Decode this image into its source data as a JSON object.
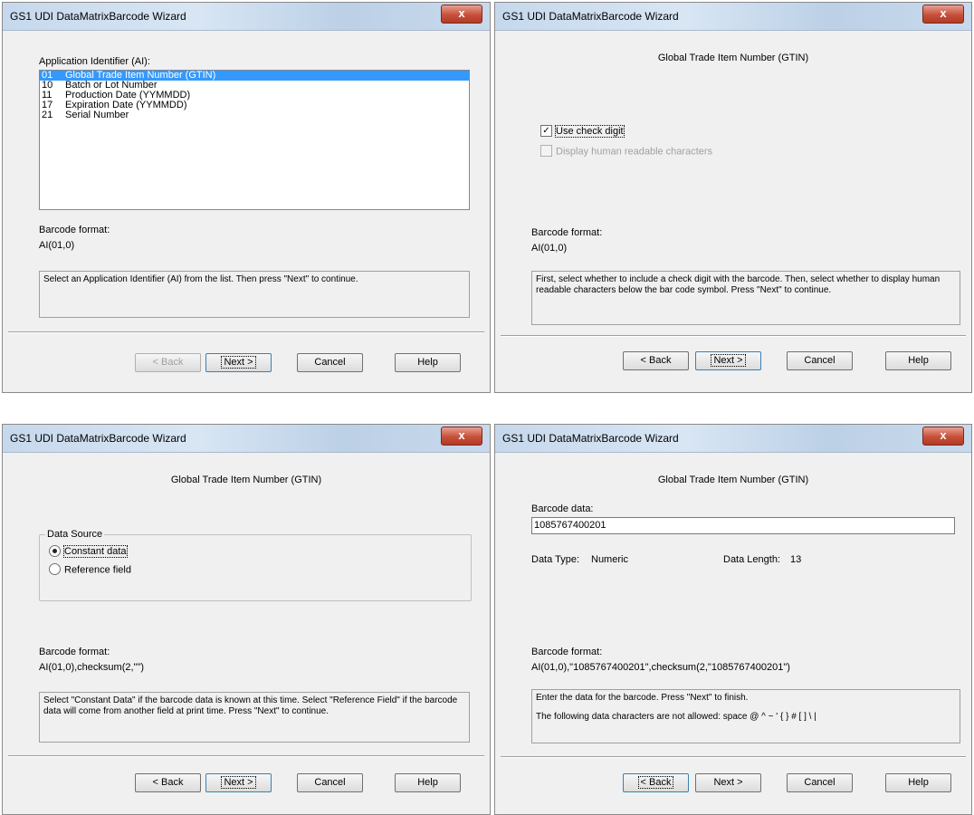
{
  "window_title": "GS1 UDI DataMatrixBarcode Wizard",
  "close_glyph": "x",
  "buttons": {
    "back": "< Back",
    "next": "Next >",
    "cancel": "Cancel",
    "help": "Help"
  },
  "barcode_format_label": "Barcode format:",
  "panel1": {
    "ai_label": "Application Identifier (AI):",
    "ai_items": [
      {
        "code": "01",
        "name": "Global Trade Item Number (GTIN)"
      },
      {
        "code": "10",
        "name": "Batch or Lot Number"
      },
      {
        "code": "11",
        "name": "Production Date (YYMMDD)"
      },
      {
        "code": "17",
        "name": "Expiration Date (YYMMDD)"
      },
      {
        "code": "21",
        "name": "Serial Number"
      }
    ],
    "selected_index": 0,
    "barcode_format": "AI(01,0)",
    "description": "Select an Application Identifier (AI) from the list. Then press \"Next\" to continue."
  },
  "panel2": {
    "title": "Global Trade Item Number (GTIN)",
    "use_check_digit": "Use check digit",
    "display_human_readable": "Display human readable characters",
    "barcode_format": "AI(01,0)",
    "description": "First, select whether to include a check digit with the barcode. Then, select whether to display human readable characters below the bar code symbol. Press \"Next\" to continue."
  },
  "panel3": {
    "title": "Global Trade Item Number (GTIN)",
    "data_source_label": "Data Source",
    "constant_data": "Constant data",
    "reference_field": "Reference field",
    "barcode_format": "AI(01,0),checksum(2,\"\")",
    "description": "Select \"Constant Data\" if the barcode data is known at this time. Select \"Reference Field\" if the barcode data will come from another field at print time. Press \"Next\" to continue."
  },
  "panel4": {
    "title": "Global Trade Item Number (GTIN)",
    "barcode_data_label": "Barcode data:",
    "barcode_data_value": "1085767400201",
    "data_type_label": "Data Type:",
    "data_type_value": "Numeric",
    "data_length_label": "Data Length:",
    "data_length_value": "13",
    "barcode_format": "AI(01,0),\"1085767400201\",checksum(2,\"1085767400201\")",
    "description_line1": "Enter the data for the barcode. Press \"Next\" to finish.",
    "description_line2": "The following data characters are not allowed: space @ ^ ~ ' { } # [ ] \\ |"
  }
}
